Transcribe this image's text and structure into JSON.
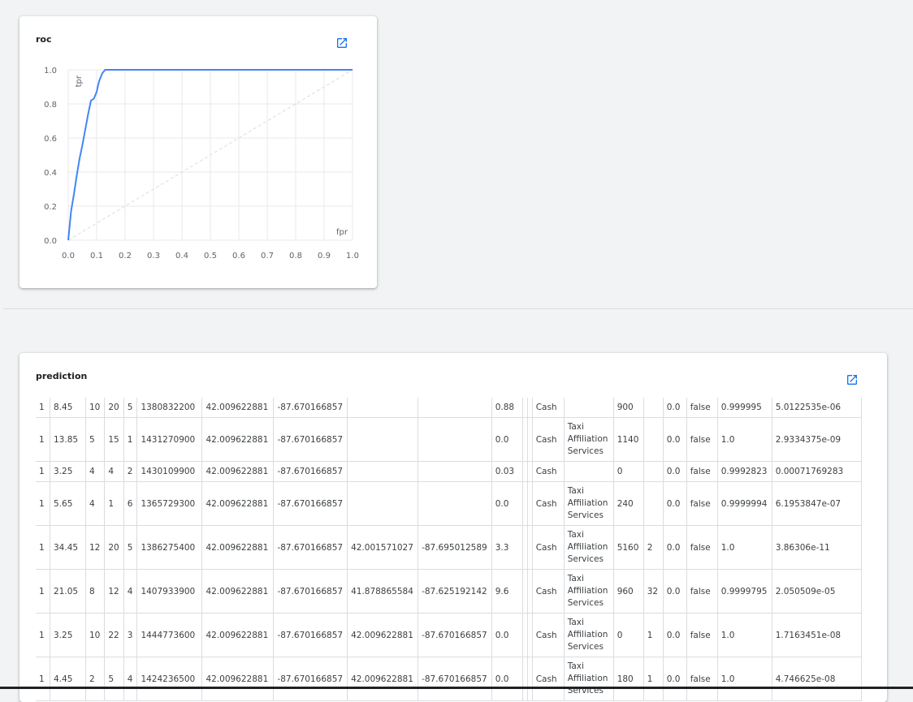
{
  "roc": {
    "title": "roc",
    "open_icon": "open-in-new-icon",
    "accent_color": "#4285f4",
    "chart_data": {
      "type": "line",
      "title": "roc",
      "xlabel": "fpr",
      "ylabel": "tpr",
      "xlim": [
        0.0,
        1.0
      ],
      "ylim": [
        0.0,
        1.0
      ],
      "x_ticks": [
        "0.0",
        "0.1",
        "0.2",
        "0.3",
        "0.4",
        "0.5",
        "0.6",
        "0.7",
        "0.8",
        "0.9",
        "1.0"
      ],
      "y_ticks": [
        "0.0",
        "0.2",
        "0.4",
        "0.6",
        "0.8",
        "1.0"
      ],
      "grid": true,
      "series": [
        {
          "x": [
            0.0,
            0.01,
            0.02,
            0.03,
            0.04,
            0.05,
            0.06,
            0.07,
            0.08,
            0.09,
            0.1,
            0.105,
            0.11,
            0.115,
            0.12,
            0.13,
            0.14,
            1.0
          ],
          "y": [
            0.0,
            0.17,
            0.27,
            0.38,
            0.48,
            0.56,
            0.65,
            0.74,
            0.82,
            0.83,
            0.87,
            0.91,
            0.94,
            0.96,
            0.98,
            1.0,
            1.0,
            1.0
          ],
          "color": "#4285f4"
        },
        {
          "x": [
            0.0,
            1.0
          ],
          "y": [
            0.0,
            1.0
          ],
          "color": "#dadce0",
          "dashed": true
        }
      ]
    }
  },
  "prediction": {
    "title": "prediction",
    "open_icon": "open-in-new-icon",
    "rows": [
      [
        "1",
        "8.45",
        "10",
        "20",
        "5",
        "1380832200",
        "42.009622881",
        "-87.670166857",
        "",
        "",
        "0.88",
        "",
        "",
        "Cash",
        "",
        "900",
        "",
        "0.0",
        "false",
        "0.999995",
        "5.0122535e-06"
      ],
      [
        "1",
        "13.85",
        "5",
        "15",
        "1",
        "1431270900",
        "42.009622881",
        "-87.670166857",
        "",
        "",
        "0.0",
        "",
        "",
        "Cash",
        "Taxi Affiliation Services",
        "1140",
        "",
        "0.0",
        "false",
        "1.0",
        "2.9334375e-09"
      ],
      [
        "1",
        "3.25",
        "4",
        "4",
        "2",
        "1430109900",
        "42.009622881",
        "-87.670166857",
        "",
        "",
        "0.03",
        "",
        "",
        "Cash",
        "",
        "0",
        "",
        "0.0",
        "false",
        "0.9992823",
        "0.00071769283"
      ],
      [
        "1",
        "5.65",
        "4",
        "1",
        "6",
        "1365729300",
        "42.009622881",
        "-87.670166857",
        "",
        "",
        "0.0",
        "",
        "",
        "Cash",
        "Taxi Affiliation Services",
        "240",
        "",
        "0.0",
        "false",
        "0.9999994",
        "6.1953847e-07"
      ],
      [
        "1",
        "34.45",
        "12",
        "20",
        "5",
        "1386275400",
        "42.009622881",
        "-87.670166857",
        "42.001571027",
        "-87.695012589",
        "3.3",
        "",
        "",
        "Cash",
        "Taxi Affiliation Services",
        "5160",
        "2",
        "0.0",
        "false",
        "1.0",
        "3.86306e-11"
      ],
      [
        "1",
        "21.05",
        "8",
        "12",
        "4",
        "1407933900",
        "42.009622881",
        "-87.670166857",
        "41.878865584",
        "-87.625192142",
        "9.6",
        "",
        "",
        "Cash",
        "Taxi Affiliation Services",
        "960",
        "32",
        "0.0",
        "false",
        "0.9999795",
        "2.050509e-05"
      ],
      [
        "1",
        "3.25",
        "10",
        "22",
        "3",
        "1444773600",
        "42.009622881",
        "-87.670166857",
        "42.009622881",
        "-87.670166857",
        "0.0",
        "",
        "",
        "Cash",
        "Taxi Affiliation Services",
        "0",
        "1",
        "0.0",
        "false",
        "1.0",
        "1.7163451e-08"
      ],
      [
        "1",
        "4.45",
        "2",
        "5",
        "4",
        "1424236500",
        "42.009622881",
        "-87.670166857",
        "42.009622881",
        "-87.670166857",
        "0.0",
        "",
        "",
        "Cash",
        "Taxi Affiliation Services",
        "180",
        "1",
        "0.0",
        "false",
        "1.0",
        "4.746625e-08"
      ]
    ]
  }
}
